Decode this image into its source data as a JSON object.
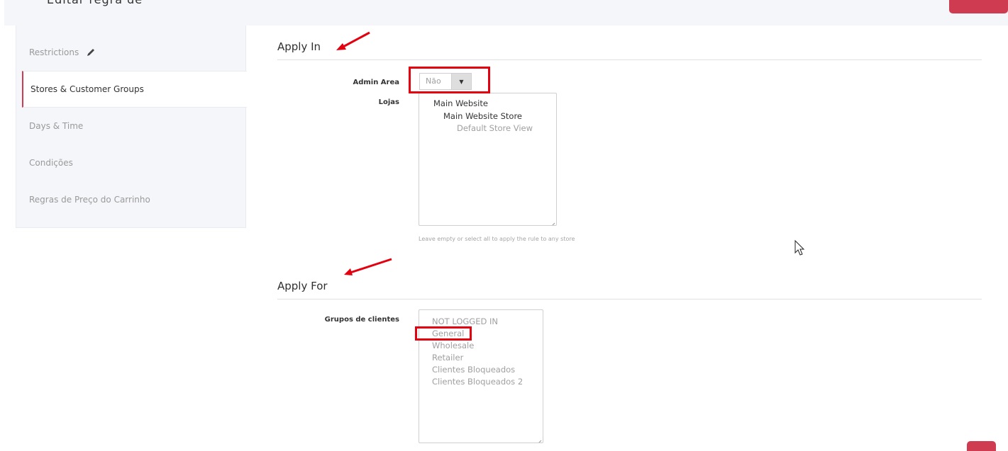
{
  "header": {
    "title": "Editar regra de preço",
    "action_button_color": "#cf3c52"
  },
  "sidebar": {
    "items": [
      {
        "label": "Restrictions",
        "icon": "pencil-icon"
      },
      {
        "label": "Stores & Customer Groups",
        "active": true
      },
      {
        "label": "Days & Time"
      },
      {
        "label": "Condições"
      },
      {
        "label": "Regras de Preço do Carrinho"
      }
    ]
  },
  "apply_in": {
    "title": "Apply In",
    "admin_area": {
      "label": "Admin Area",
      "value": "Não",
      "arrow_icon": "triangle-down-icon"
    },
    "stores": {
      "label": "Lojas",
      "options": [
        "Main Website",
        "Main Website Store",
        "Default Store View"
      ],
      "hint": "Leave empty or select all to apply the rule to any store"
    }
  },
  "apply_for": {
    "title": "Apply For",
    "customer_groups": {
      "label": "Grupos de clientes",
      "options": [
        "NOT LOGGED IN",
        "General",
        "Wholesale",
        "Retailer",
        "Clientes Bloqueados",
        "Clientes Bloqueados 2"
      ]
    }
  },
  "annotations": {
    "color": "#e3000f",
    "cursor_icon": "mouse-pointer-icon"
  }
}
